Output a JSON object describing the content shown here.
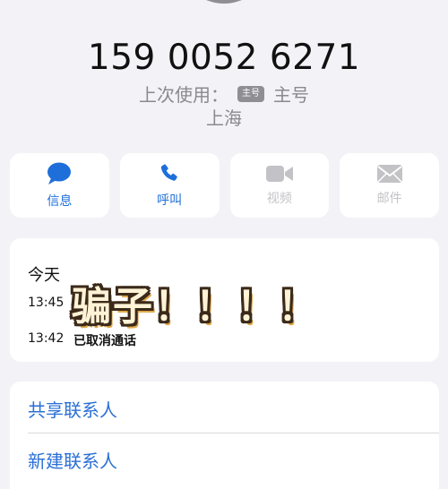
{
  "header": {
    "phone_number": "159 0052 6271",
    "last_used_label": "上次使用：",
    "sim_tag": "主号",
    "sim_name": "主号",
    "location": "上海"
  },
  "actions": [
    {
      "label": "信息",
      "icon": "message-icon",
      "enabled": true
    },
    {
      "label": "呼叫",
      "icon": "phone-icon",
      "enabled": true
    },
    {
      "label": "视频",
      "icon": "video-icon",
      "enabled": false
    },
    {
      "label": "邮件",
      "icon": "mail-icon",
      "enabled": false
    }
  ],
  "recents": {
    "day": "今天",
    "calls": [
      {
        "time": "13:45",
        "status": ""
      },
      {
        "time": "13:42",
        "status": "已取消通话"
      }
    ]
  },
  "overlay": {
    "text": "骗子！！！！"
  },
  "contacts": {
    "share": "共享联系人",
    "new": "新建联系人"
  },
  "colors": {
    "accent": "#1e6fd9",
    "disabled": "#c3c3c7",
    "background": "#f2f2f7"
  }
}
